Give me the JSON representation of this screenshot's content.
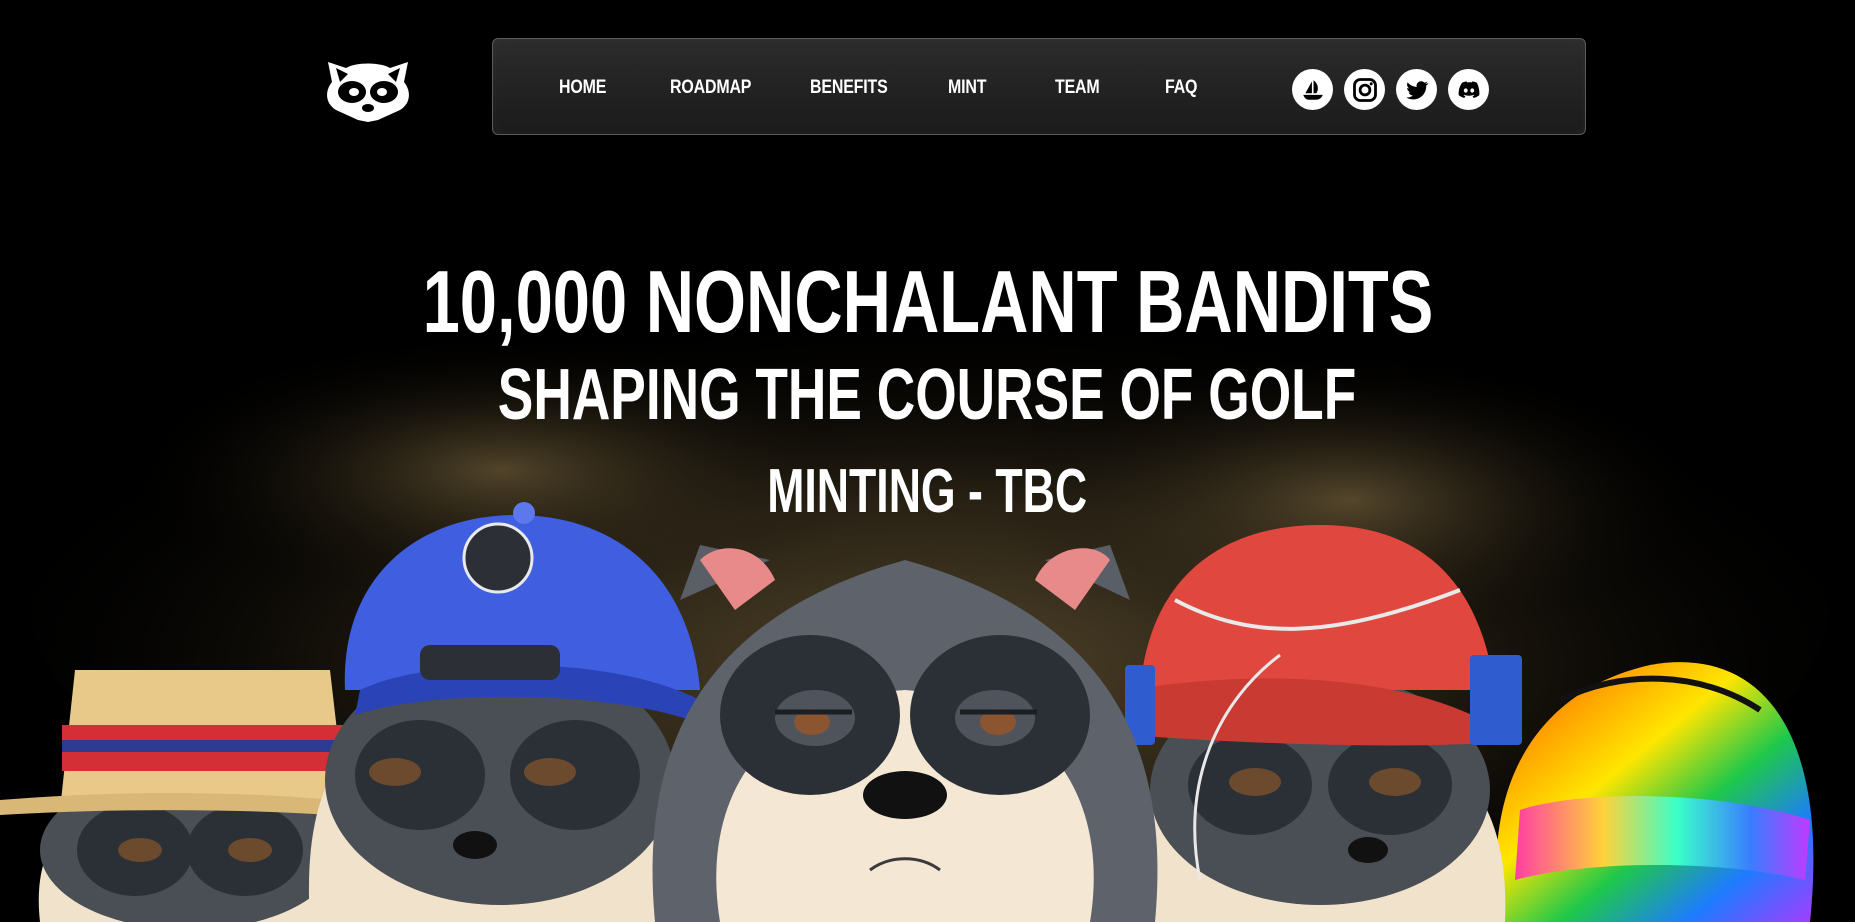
{
  "nav": {
    "links": [
      "HOME",
      "ROADMAP",
      "BENEFITS",
      "MINT",
      "TEAM",
      "FAQ"
    ],
    "socials": [
      "opensea-icon",
      "instagram-icon",
      "twitter-icon",
      "discord-icon"
    ]
  },
  "hero": {
    "title": "10,000 NONCHALANT BANDITS",
    "subtitle": "SHAPING THE COURSE OF GOLF",
    "minting": "MINTING - TBC"
  },
  "colors": {
    "background": "#000000",
    "nav_bg": "#232323",
    "nav_border": "#5a5a5a",
    "text": "#ffffff",
    "blue_cap": "#3f5fe0",
    "red_cap": "#e0473f",
    "straw_hat": "#e8c98a",
    "fur_dark": "#3b3f44",
    "fur_light": "#f3e6d3"
  }
}
